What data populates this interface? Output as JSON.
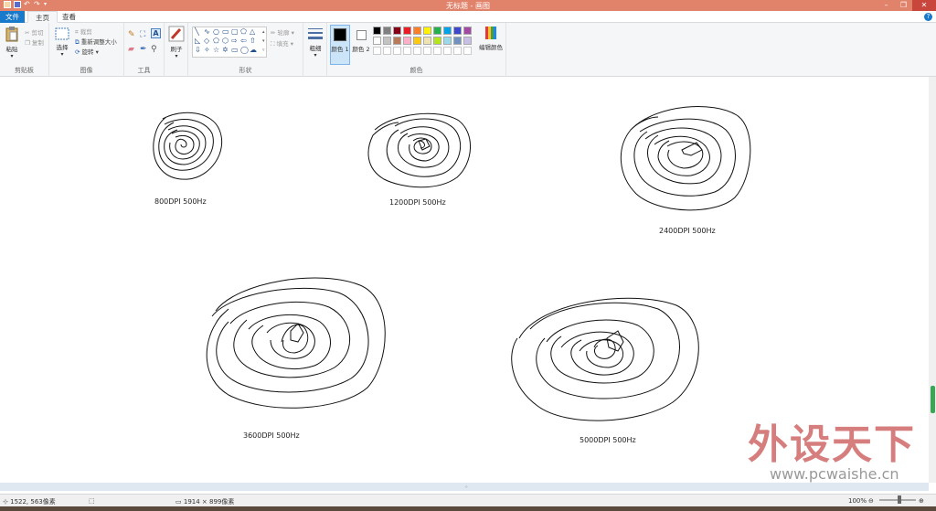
{
  "window": {
    "title": "无标题 - 画图"
  },
  "tabs": {
    "file": "文件",
    "home": "主页",
    "view": "查看"
  },
  "ribbon": {
    "clipboard": {
      "paste": "粘贴",
      "cut": "剪切",
      "copy": "复制",
      "group": "剪贴板"
    },
    "image": {
      "select": "选择",
      "crop": "裁剪",
      "resize": "重新调整大小",
      "rotate": "旋转",
      "group": "图像"
    },
    "tools": {
      "group": "工具"
    },
    "brushes": {
      "label": "刷子"
    },
    "shapes": {
      "outline": "轮廓",
      "fill": "填充",
      "group": "形状"
    },
    "size": {
      "label": "粗细"
    },
    "colors": {
      "color1": "颜色 1",
      "color2": "颜色 2",
      "edit": "编辑颜色",
      "group": "颜色",
      "palette_row1": [
        "#000000",
        "#7f7f7f",
        "#880015",
        "#ed1c24",
        "#ff7f27",
        "#fff200",
        "#22b14c",
        "#00a2e8",
        "#3f48cc",
        "#a349a4"
      ],
      "palette_row2": [
        "#ffffff",
        "#c3c3c3",
        "#b97a57",
        "#ffaec9",
        "#ffc90e",
        "#efe4b0",
        "#b5e61d",
        "#99d9ea",
        "#7092be",
        "#c8bfe7"
      ],
      "color1_value": "#000000",
      "color2_value": "#ffffff"
    }
  },
  "canvas": {
    "labels": [
      "800DPI  500Hz",
      "1200DPI  500Hz",
      "2400DPI  500Hz",
      "3600DPI  500Hz",
      "5000DPI  500Hz"
    ]
  },
  "statusbar": {
    "cursor_pos": "1522, 563像素",
    "image_size": "1914 × 899像素",
    "zoom": "100%"
  },
  "watermark": {
    "big": "外设天下",
    "small": "www.pcwaishe.cn"
  }
}
